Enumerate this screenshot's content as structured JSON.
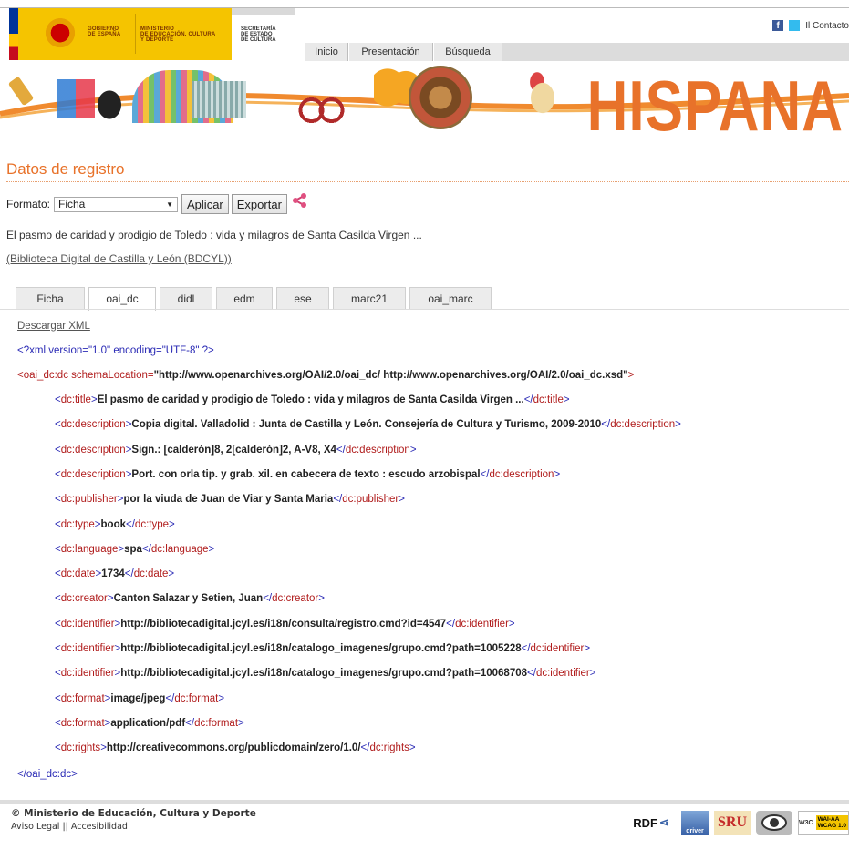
{
  "header": {
    "gov_1": "GOBIERNO",
    "gov_2": "DE ESPAÑA",
    "min_1": "MINISTERIO",
    "min_2": "DE EDUCACIÓN, CULTURA",
    "min_3": "Y DEPORTE",
    "sec_1": "SECRETARÍA",
    "sec_2": "DE ESTADO",
    "sec_3": "DE CULTURA",
    "social_fb": "f",
    "contact": "Il Contacto",
    "nav": [
      "Inicio",
      "Presentación",
      "Búsqueda"
    ],
    "brand": "HISPANA"
  },
  "page": {
    "title": "Datos de registro",
    "format_label": "Formato:",
    "format_value": "Ficha",
    "apply_label": "Aplicar",
    "export_label": "Exportar",
    "record_title": "El pasmo de caridad y prodigio de Toledo : vida y milagros de Santa Casilda Virgen ...",
    "record_source": "(Biblioteca Digital de Castilla y León (BDCYL))"
  },
  "tabs": [
    "Ficha",
    "oai_dc",
    "didl",
    "edm",
    "ese",
    "marc21",
    "oai_marc"
  ],
  "active_tab": "oai_dc",
  "xml": {
    "download": "Descargar XML",
    "decl": "<?xml version=\"1.0\" encoding=\"UTF-8\" ?>",
    "root_open_tag": "<oai_dc:dc schemaLocation=",
    "root_open_val": "\"http://www.openarchives.org/OAI/2.0/oai_dc/ http://www.openarchives.org/OAI/2.0/oai_dc.xsd\"",
    "root_open_end": ">",
    "root_close": "</oai_dc:dc>",
    "elements": [
      {
        "tag": "dc:title",
        "value": "El pasmo de caridad y prodigio de Toledo : vida y milagros de Santa Casilda Virgen ..."
      },
      {
        "tag": "dc:description",
        "value": "Copia digital. Valladolid : Junta de Castilla y León. Consejería de Cultura y Turismo, 2009-2010"
      },
      {
        "tag": "dc:description",
        "value": "Sign.: [calderón]8, 2[calderón]2, A-V8, X4"
      },
      {
        "tag": "dc:description",
        "value": "Port. con orla tip. y grab. xil. en cabecera de texto : escudo arzobispal"
      },
      {
        "tag": "dc:publisher",
        "value": "por la viuda de Juan de Viar y Santa Maria"
      },
      {
        "tag": "dc:type",
        "value": "book"
      },
      {
        "tag": "dc:language",
        "value": "spa"
      },
      {
        "tag": "dc:date",
        "value": "1734"
      },
      {
        "tag": "dc:creator",
        "value": "Canton Salazar y Setien, Juan"
      },
      {
        "tag": "dc:identifier",
        "value": "http://bibliotecadigital.jcyl.es/i18n/consulta/registro.cmd?id=4547"
      },
      {
        "tag": "dc:identifier",
        "value": "http://bibliotecadigital.jcyl.es/i18n/catalogo_imagenes/grupo.cmd?path=1005228"
      },
      {
        "tag": "dc:identifier",
        "value": "http://bibliotecadigital.jcyl.es/i18n/catalogo_imagenes/grupo.cmd?path=10068708"
      },
      {
        "tag": "dc:format",
        "value": "image/jpeg"
      },
      {
        "tag": "dc:format",
        "value": "application/pdf"
      },
      {
        "tag": "dc:rights",
        "value": "http://creativecommons.org/publicdomain/zero/1.0/"
      }
    ]
  },
  "footer": {
    "copyright": "© Ministerio de Educación, Cultura y Deporte",
    "links": "Aviso Legal  || Accesibilidad",
    "badge_rdf": "RDF",
    "badge_driver": "driver",
    "badge_sru": "SRU",
    "badge_wcag_w3c": "W3C",
    "badge_wcag": "WAI-AA WCAG 1.0"
  },
  "colors": {
    "accent": "#e8722a",
    "xml_tag": "#b01c1c",
    "xml_markup": "#2a2ab5"
  }
}
